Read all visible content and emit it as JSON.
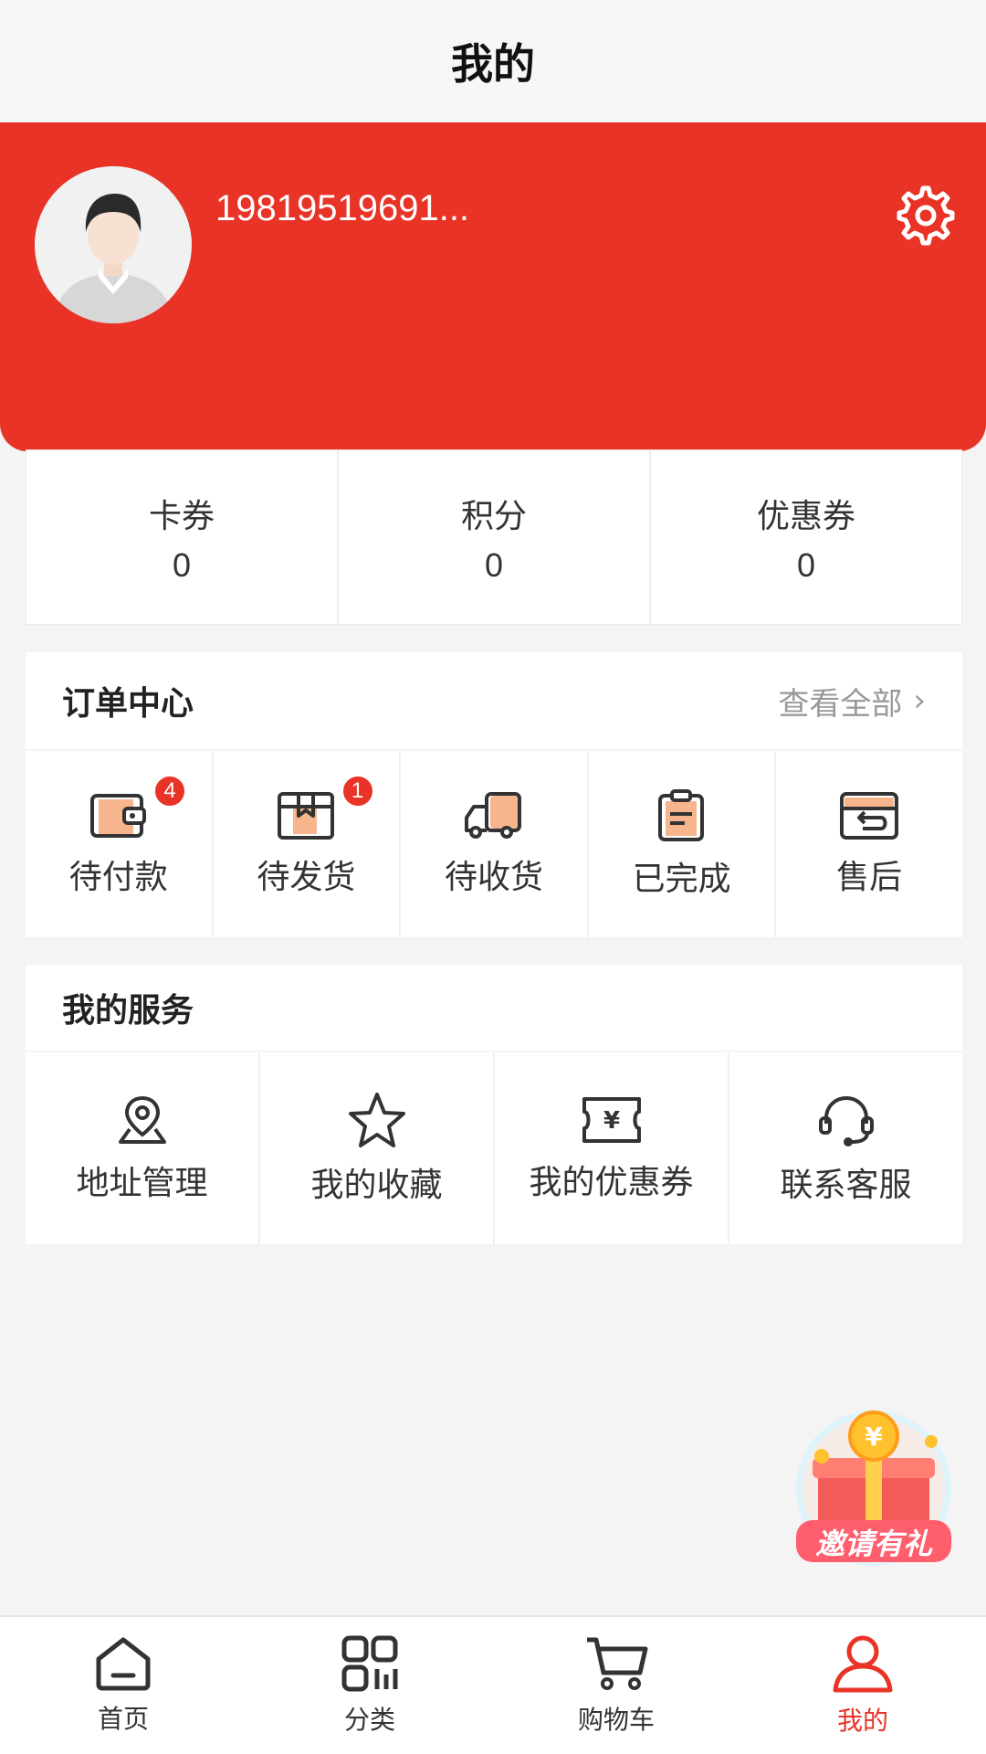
{
  "header": {
    "title": "我的"
  },
  "profile": {
    "username": "19819519691...",
    "avatar_icon": "avatar-icon",
    "settings_icon": "gear-icon",
    "accent_color": "#e83326"
  },
  "stats": [
    {
      "label": "卡券",
      "value": "0"
    },
    {
      "label": "积分",
      "value": "0"
    },
    {
      "label": "优惠券",
      "value": "0"
    }
  ],
  "orders": {
    "title": "订单中心",
    "view_all": "查看全部",
    "items": [
      {
        "label": "待付款",
        "icon": "wallet-icon",
        "badge": "4"
      },
      {
        "label": "待发货",
        "icon": "box-icon",
        "badge": "1"
      },
      {
        "label": "待收货",
        "icon": "truck-icon",
        "badge": ""
      },
      {
        "label": "已完成",
        "icon": "clipboard-icon",
        "badge": ""
      },
      {
        "label": "售后",
        "icon": "return-card-icon",
        "badge": ""
      }
    ]
  },
  "services": {
    "title": "我的服务",
    "items": [
      {
        "label": "地址管理",
        "icon": "location-icon"
      },
      {
        "label": "我的收藏",
        "icon": "star-icon"
      },
      {
        "label": "我的优惠券",
        "icon": "coupon-icon"
      },
      {
        "label": "联系客服",
        "icon": "headset-icon"
      }
    ]
  },
  "promo": {
    "label": "邀请有礼",
    "icon": "gift-icon"
  },
  "bottom_nav": {
    "items": [
      {
        "label": "首页",
        "icon": "home-icon",
        "active": false
      },
      {
        "label": "分类",
        "icon": "category-icon",
        "active": false
      },
      {
        "label": "购物车",
        "icon": "cart-icon",
        "active": false
      },
      {
        "label": "我的",
        "icon": "user-icon",
        "active": true
      }
    ]
  }
}
